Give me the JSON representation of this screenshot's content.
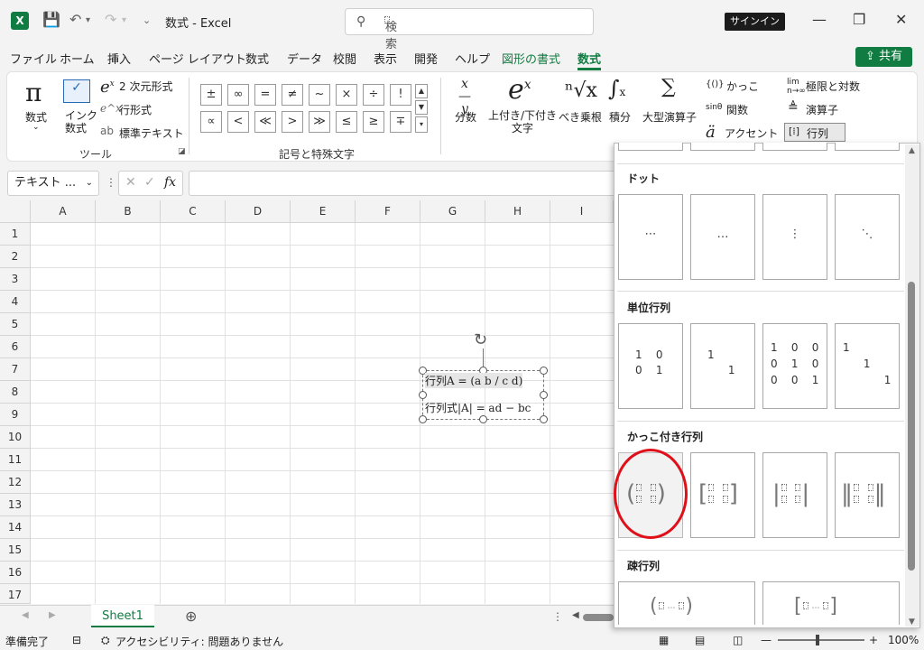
{
  "window": {
    "title": "数式 - Excel",
    "search_placeholder": "検索",
    "signin": "サインイン",
    "share": "共有"
  },
  "menu": [
    "ファイル",
    "ホーム",
    "挿入",
    "ページ レイアウト",
    "数式",
    "データ",
    "校閲",
    "表示",
    "開発",
    "ヘルプ",
    "図形の書式",
    "数式"
  ],
  "ribbon": {
    "equation": "数式",
    "ink": "インク\n数式",
    "professional": "2 次元形式",
    "linear": "行形式",
    "normal_text": "標準テキスト",
    "tools_group": "ツール",
    "symbols_group": "記号と特殊文字",
    "symbols_row1": [
      "±",
      "∞",
      "=",
      "≠",
      "~",
      "×",
      "÷",
      "!"
    ],
    "symbols_row2": [
      "∝",
      "<",
      "≪",
      ">",
      "≫",
      "≤",
      "≥",
      "∓"
    ],
    "fraction": "分数",
    "script": "上付き/下付き\n文字",
    "radical": "べき乗根",
    "integral": "積分",
    "large_operator": "大型演算子",
    "bracket": "かっこ",
    "function": "関数",
    "accent": "アクセント",
    "limit_log": "極限と対数",
    "operator": "演算子",
    "matrix": "行列"
  },
  "formula_bar": {
    "name_box": "テキスト ...",
    "fx": "fx"
  },
  "columns": [
    "A",
    "B",
    "C",
    "D",
    "E",
    "F",
    "G",
    "H",
    "I"
  ],
  "rows": [
    "1",
    "2",
    "3",
    "4",
    "5",
    "6",
    "7",
    "8",
    "9",
    "10",
    "11",
    "12",
    "13",
    "14",
    "15",
    "16",
    "17"
  ],
  "equation_box": {
    "line1": "行列A = (a b / c d)",
    "line2": "行列式|A| = ad − bc"
  },
  "sheet_tab": "Sheet1",
  "status": {
    "ready": "準備完了",
    "accessibility": "アクセシビリティ: 問題ありません",
    "zoom": "100%"
  },
  "gallery": {
    "dots_title": "ドット",
    "identity_title": "単位行列",
    "bracket_title": "かっこ付き行列",
    "sparse_title": "疎行列",
    "dots": [
      "⋯",
      "…",
      "⋮",
      "⋱"
    ]
  }
}
